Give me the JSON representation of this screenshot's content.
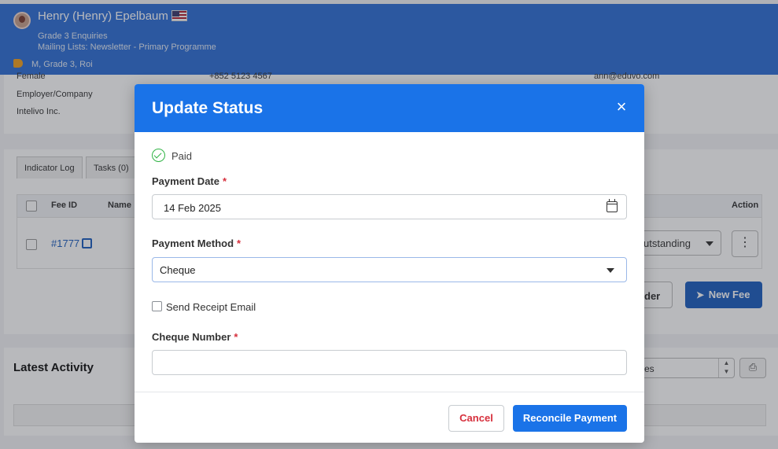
{
  "background": {
    "header": {
      "name": "Henry (Henry) Epelbaum",
      "subtitle1": "Grade 3 Enquiries",
      "subtitle2": "Mailing Lists: Newsletter - Primary Programme",
      "tags": "M, Grade 3, Roi"
    },
    "details": {
      "gender": "Female",
      "phone": "+852 5123 4567",
      "email": "ann@eduvo.com",
      "employer_label": "Employer/Company",
      "employer_value": "Intelivo Inc."
    },
    "tabs": [
      "Indicator Log",
      "Tasks (0)"
    ],
    "fees_table": {
      "headers": {
        "fee_id": "Fee ID",
        "name": "Name",
        "action": "Action"
      },
      "row": {
        "fee_id": "#1777",
        "status": "utstanding"
      }
    },
    "buttons": {
      "order": "der",
      "new_fee": "New Fee"
    },
    "activity": {
      "title": "Latest Activity",
      "filter": "es"
    }
  },
  "modal": {
    "title": "Update Status",
    "status_label": "Paid",
    "payment_date_label": "Payment Date",
    "payment_date_value": "14 Feb 2025",
    "payment_method_label": "Payment Method",
    "payment_method_value": "Cheque",
    "send_receipt_label": "Send Receipt Email",
    "cheque_number_label": "Cheque Number",
    "cheque_number_value": "",
    "required_marker": "*",
    "close_symbol": "×",
    "cancel_label": "Cancel",
    "reconcile_label": "Reconcile Payment"
  },
  "colors": {
    "primary": "#1a73e8",
    "danger": "#d62f3c",
    "success": "#2fb344"
  }
}
